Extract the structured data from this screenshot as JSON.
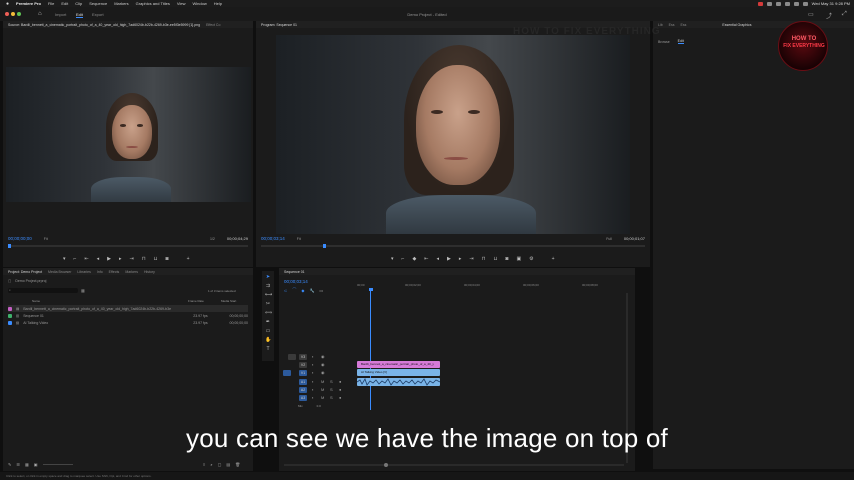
{
  "menubar": {
    "items": [
      "Premiere Pro",
      "File",
      "Edit",
      "Clip",
      "Sequence",
      "Markers",
      "Graphics and Titles",
      "View",
      "Window",
      "Help"
    ],
    "clock": "Wed May 31  9:28 PM"
  },
  "appbar": {
    "workspaces": [
      "Import",
      "Edit",
      "Export"
    ],
    "title": "Demo Project - Edited"
  },
  "source_monitor": {
    "tab": "Source: Bardli_bennett_a_cinematic_portrait_photo_of_a_40_year_old_high_7ad6024b-b22b-4269-b3e-ee5f3e5999 [1].png",
    "tab2": "Effect Co",
    "timecode": "00;00;00;00",
    "fit": "Fit",
    "fraction": "1/2",
    "duration": "00;00;04;29"
  },
  "program_monitor": {
    "tab": "Program: Sequence 01",
    "timecode": "00;00;03;14",
    "fit": "Fit",
    "fraction": "Full",
    "duration": "00;00;01;07"
  },
  "right_panel": {
    "tabs": [
      "Lib",
      "Ess",
      "Ess"
    ],
    "essential": "Essential Graphics",
    "browse": "Browse",
    "edit": "Edit",
    "watermark": "HOW TO FIX EVERYTHING"
  },
  "badge": {
    "line1": "HOW TO",
    "line2": "FIX EVERYTHING"
  },
  "project_panel": {
    "tabs": [
      "Project: Demo Project",
      "Media Browser",
      "Libraries",
      "Info",
      "Effects",
      "Markers",
      "History"
    ],
    "project_file": "Demo Project.prproj",
    "items_selected": "1 of 3 items selected",
    "columns": {
      "name": "Name",
      "frame_rate": "Frame Rate",
      "media_start": "Media Start"
    },
    "rows": [
      {
        "name": "Bardli_bennett_a_cinematic_portrait_photo_of_a_40_year_old_high_7ad6024b-b22b-4269-b3e",
        "rate": "",
        "start": "",
        "color": "#c45fc4"
      },
      {
        "name": "Sequence 01",
        "rate": "23.97 fps",
        "start": "00;00;00;00",
        "color": "#3fb06b"
      },
      {
        "name": "AI Talking Video",
        "rate": "23.97 fps",
        "start": "00;00;00;00",
        "color": "#3a8cff"
      }
    ]
  },
  "timeline": {
    "tab": "Sequence 01",
    "timecode": "00;00;03;14",
    "ruler": [
      "00;00",
      "00;00;02;00",
      "00;00;04;00",
      "00;00;06;00",
      "00;00;08;00"
    ],
    "tracks": [
      {
        "label": "V3",
        "name": "V3"
      },
      {
        "label": "V2",
        "name": "V2"
      },
      {
        "label": "V1",
        "name": "V1"
      },
      {
        "label": "A1",
        "name": "A1"
      },
      {
        "label": "A2",
        "name": "A2"
      },
      {
        "label": "A3",
        "name": "A3"
      }
    ],
    "mix": "Mix",
    "mix_val": "0.0",
    "clips": {
      "image": "Bardli_bennett_a_cinematic_portrait_photo_of_a_40_y",
      "video": "AI Talking Video [V]"
    }
  },
  "caption": "you can see we have the image on top of",
  "statusbar": "Click to select, or click in empty space and drag to marquee select. Use Shift, Opt, and Cmd for other options."
}
